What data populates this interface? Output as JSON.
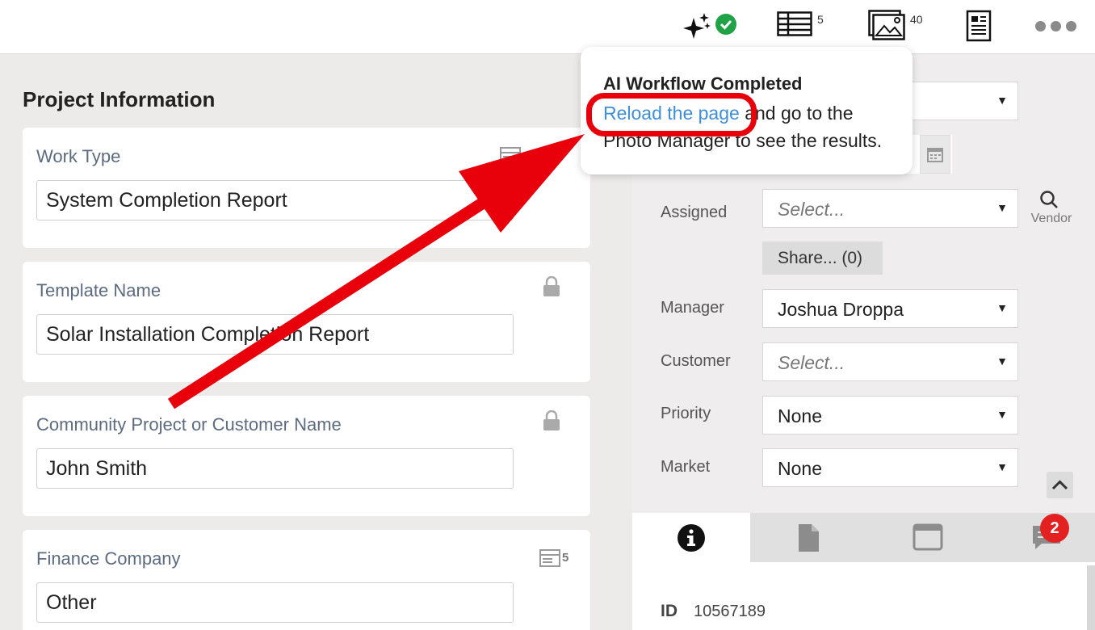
{
  "topbar": {
    "ai_icon": "sparkle-icon",
    "ai_status_icon": "check-circle-icon",
    "table_count": "5",
    "photos_count": "40",
    "more_icon": "more-dots-icon"
  },
  "left": {
    "section_title": "Project Information",
    "cards": [
      {
        "label": "Work Type",
        "value": "System Completion Report",
        "icon": "form-icon"
      },
      {
        "label": "Template Name",
        "value": "Solar Installation Completion Report",
        "icon": "lock-icon"
      },
      {
        "label": "Community Project or Customer Name",
        "value": "John Smith",
        "icon": "lock-icon"
      },
      {
        "label": "Finance Company",
        "value": "Other",
        "icon": "form-icon",
        "icon_count": "5"
      }
    ]
  },
  "right": {
    "assigned_label": "Assigned",
    "assigned_placeholder": "Select...",
    "vendor_label": "Vendor",
    "share_label": "Share... (0)",
    "manager_label": "Manager",
    "manager_value": "Joshua Droppa",
    "customer_label": "Customer",
    "customer_placeholder": "Select...",
    "priority_label": "Priority",
    "priority_value": "None",
    "market_label": "Market",
    "market_value": "None",
    "caret": "▼",
    "comments_badge": "2",
    "id_label": "ID",
    "id_value": "10567189"
  },
  "popup": {
    "title": "AI Workflow Completed",
    "link_text": "Reload the page",
    "body_rest": " and go to the Photo Manager to see the results."
  },
  "colors": {
    "accent_red": "#e8000b",
    "link_blue": "#3d8fdc",
    "check_green": "#1fa346",
    "badge_red": "#e42121"
  }
}
